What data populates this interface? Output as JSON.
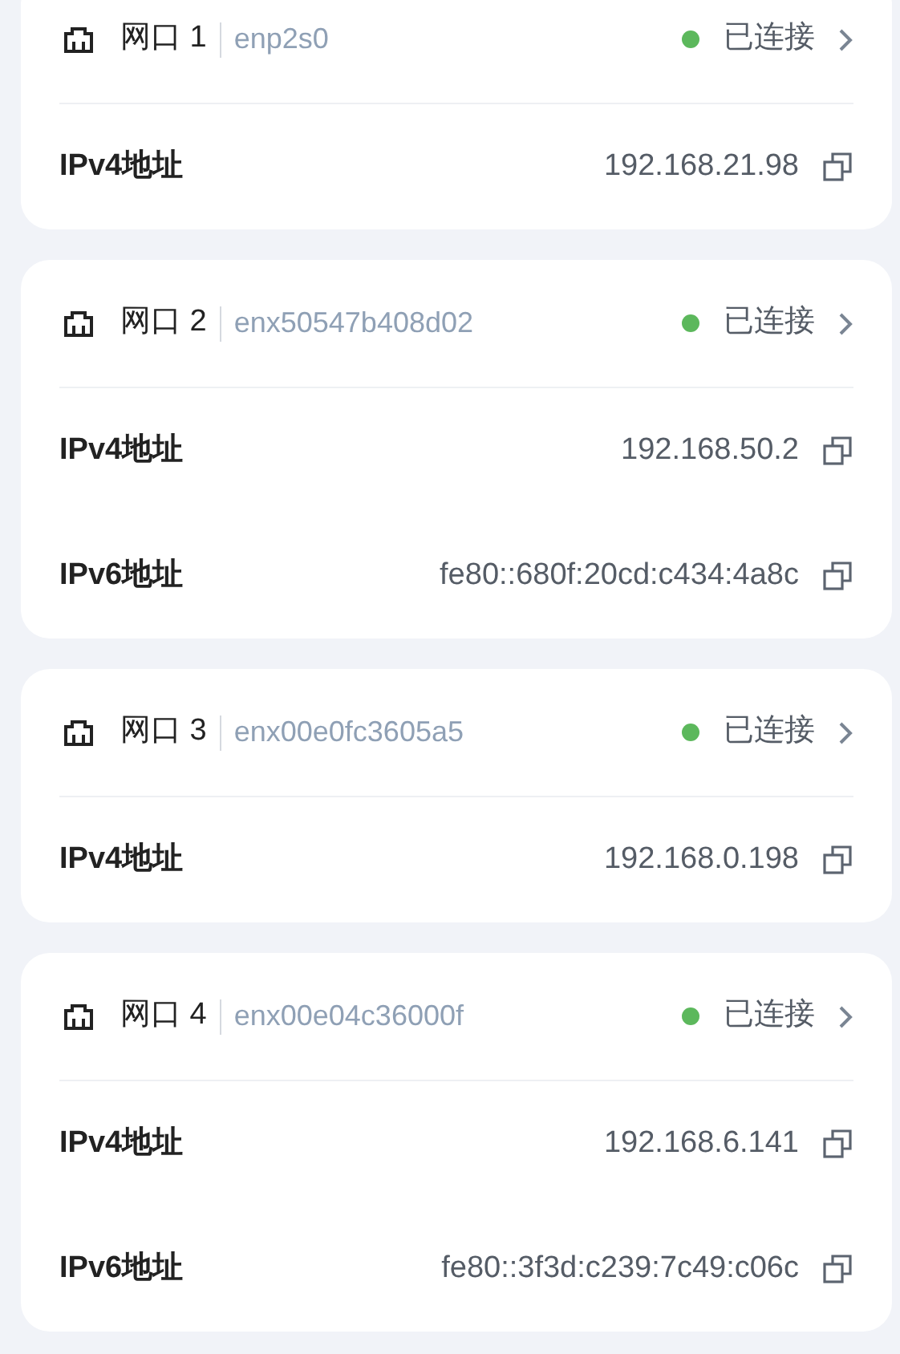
{
  "interfaces": [
    {
      "name": "网口 1",
      "device": "enp2s0",
      "status": "已连接",
      "color": "#5cb85c",
      "addresses": [
        {
          "label": "IPv4地址",
          "value": "192.168.21.98"
        }
      ]
    },
    {
      "name": "网口 2",
      "device": "enx50547b408d02",
      "status": "已连接",
      "color": "#5cb85c",
      "addresses": [
        {
          "label": "IPv4地址",
          "value": "192.168.50.2"
        },
        {
          "label": "IPv6地址",
          "value": "fe80::680f:20cd:c434:4a8c"
        }
      ]
    },
    {
      "name": "网口 3",
      "device": "enx00e0fc3605a5",
      "status": "已连接",
      "color": "#5cb85c",
      "addresses": [
        {
          "label": "IPv4地址",
          "value": "192.168.0.198"
        }
      ]
    },
    {
      "name": "网口 4",
      "device": "enx00e04c36000f",
      "status": "已连接",
      "color": "#5cb85c",
      "addresses": [
        {
          "label": "IPv4地址",
          "value": "192.168.6.141"
        },
        {
          "label": "IPv6地址",
          "value": "fe80::3f3d:c239:7c49:c06c"
        }
      ]
    }
  ]
}
